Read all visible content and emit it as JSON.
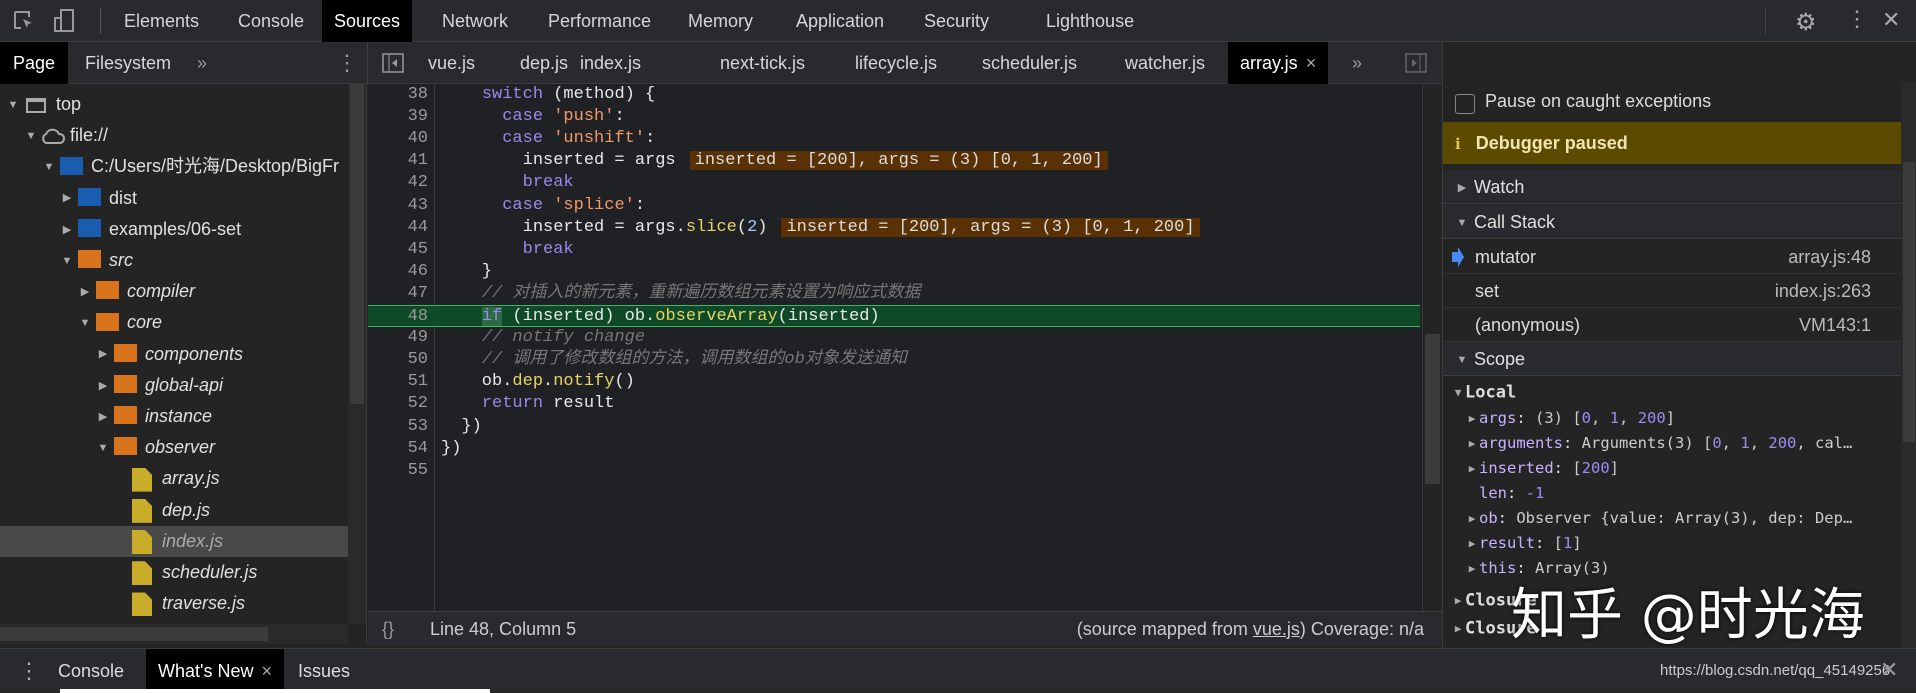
{
  "main_tabs": [
    "Elements",
    "Console",
    "Sources",
    "Network",
    "Performance",
    "Memory",
    "Application",
    "Security",
    "Lighthouse"
  ],
  "active_main_tab": "Sources",
  "navigator_tabs": {
    "page": "Page",
    "filesystem": "Filesystem",
    "more": "»"
  },
  "file_tabs": [
    "vue.js",
    "dep.js",
    "index.js",
    "next-tick.js",
    "lifecycle.js",
    "scheduler.js",
    "watcher.js",
    "array.js"
  ],
  "active_file_tab": "array.js",
  "more_tabs": "»",
  "close_glyph": "×",
  "tree": [
    {
      "label": "top",
      "depth": 0,
      "icon": "frame",
      "arrow": "down"
    },
    {
      "label": "file://",
      "depth": 1,
      "icon": "cloud",
      "arrow": "down"
    },
    {
      "label": "C:/Users/时光海/Desktop/BigFr",
      "depth": 2,
      "icon": "folder-blue",
      "arrow": "down"
    },
    {
      "label": "dist",
      "depth": 3,
      "icon": "folder-blue",
      "arrow": "right"
    },
    {
      "label": "examples/06-set",
      "depth": 3,
      "icon": "folder-blue",
      "arrow": "right"
    },
    {
      "label": "src",
      "depth": 3,
      "icon": "folder-orange",
      "arrow": "down",
      "italic": true
    },
    {
      "label": "compiler",
      "depth": 4,
      "icon": "folder-orange",
      "arrow": "right",
      "italic": true
    },
    {
      "label": "core",
      "depth": 4,
      "icon": "folder-orange",
      "arrow": "down",
      "italic": true
    },
    {
      "label": "components",
      "depth": 5,
      "icon": "folder-orange",
      "arrow": "right",
      "italic": true
    },
    {
      "label": "global-api",
      "depth": 5,
      "icon": "folder-orange",
      "arrow": "right",
      "italic": true
    },
    {
      "label": "instance",
      "depth": 5,
      "icon": "folder-orange",
      "arrow": "right",
      "italic": true
    },
    {
      "label": "observer",
      "depth": 5,
      "icon": "folder-orange",
      "arrow": "down",
      "italic": true
    },
    {
      "label": "array.js",
      "depth": 6,
      "icon": "file",
      "italic": true
    },
    {
      "label": "dep.js",
      "depth": 6,
      "icon": "file",
      "italic": true
    },
    {
      "label": "index.js",
      "depth": 6,
      "icon": "file",
      "italic": true,
      "selected": true
    },
    {
      "label": "scheduler.js",
      "depth": 6,
      "icon": "file",
      "italic": true
    },
    {
      "label": "traverse.js",
      "depth": 6,
      "icon": "file",
      "italic": true
    }
  ],
  "code": {
    "current_line": 48,
    "lines": [
      {
        "n": 38,
        "t": [
          [
            "    ",
            ""
          ],
          [
            "switch",
            "kw"
          ],
          [
            " (method) {",
            "id"
          ]
        ]
      },
      {
        "n": 39,
        "t": [
          [
            "      ",
            ""
          ],
          [
            "case",
            "kw"
          ],
          [
            " ",
            ""
          ],
          [
            "'push'",
            "str"
          ],
          [
            ":",
            "id"
          ]
        ]
      },
      {
        "n": 40,
        "t": [
          [
            "      ",
            ""
          ],
          [
            "case",
            "kw"
          ],
          [
            " ",
            ""
          ],
          [
            "'unshift'",
            "str"
          ],
          [
            ":",
            "id"
          ]
        ]
      },
      {
        "n": 41,
        "t": [
          [
            "        inserted = args",
            "id"
          ]
        ],
        "inline": "inserted = [200], args = (3) [0, 1, 200]"
      },
      {
        "n": 42,
        "t": [
          [
            "        ",
            ""
          ],
          [
            "break",
            "kw"
          ]
        ]
      },
      {
        "n": 43,
        "t": [
          [
            "      ",
            ""
          ],
          [
            "case",
            "kw"
          ],
          [
            " ",
            ""
          ],
          [
            "'splice'",
            "str"
          ],
          [
            ":",
            "id"
          ]
        ]
      },
      {
        "n": 44,
        "t": [
          [
            "        inserted = args.",
            "id"
          ],
          [
            "slice",
            "fn"
          ],
          [
            "(",
            "id"
          ],
          [
            "2",
            "num"
          ],
          [
            ")",
            "id"
          ]
        ],
        "inline": "inserted = [200], args = (3) [0, 1, 200]"
      },
      {
        "n": 45,
        "t": [
          [
            "        ",
            ""
          ],
          [
            "break",
            "kw"
          ]
        ]
      },
      {
        "n": 46,
        "t": [
          [
            "    }",
            "id"
          ]
        ]
      },
      {
        "n": 47,
        "t": [
          [
            "    ",
            ""
          ],
          [
            "// 对插入的新元素，重新遍历数组元素设置为响应式数据",
            "cm"
          ]
        ]
      },
      {
        "n": 48,
        "t": [
          [
            "    ",
            ""
          ],
          [
            "if",
            "kw"
          ],
          [
            " (inserted) ob.",
            "id"
          ],
          [
            "observeArray",
            "fn"
          ],
          [
            "(inserted)",
            "id"
          ]
        ]
      },
      {
        "n": 49,
        "t": [
          [
            "    ",
            ""
          ],
          [
            "// notify change",
            "cm"
          ]
        ]
      },
      {
        "n": 50,
        "t": [
          [
            "    ",
            ""
          ],
          [
            "// 调用了修改数组的方法，调用数组的ob对象发送通知",
            "cm"
          ]
        ]
      },
      {
        "n": 51,
        "t": [
          [
            "    ob.",
            "id"
          ],
          [
            "dep",
            "fn"
          ],
          [
            ".",
            "id"
          ],
          [
            "notify",
            "fn"
          ],
          [
            "()",
            "id"
          ]
        ]
      },
      {
        "n": 52,
        "t": [
          [
            "    ",
            ""
          ],
          [
            "return",
            "kw"
          ],
          [
            " result",
            "id"
          ]
        ]
      },
      {
        "n": 53,
        "t": [
          [
            "  })",
            "id"
          ]
        ]
      },
      {
        "n": 54,
        "t": [
          [
            "})",
            "id"
          ]
        ]
      },
      {
        "n": 55,
        "t": []
      }
    ]
  },
  "status": {
    "format_icon": "{}",
    "position": "Line 48, Column 5",
    "mapped_prefix": "(source mapped from ",
    "mapped_link": "vue.js",
    "mapped_suffix": ")",
    "coverage": "Coverage: n/a"
  },
  "debugger": {
    "pause_on_caught": "Pause on caught exceptions",
    "paused_banner": "Debugger paused",
    "info_glyph": "i",
    "watch": "Watch",
    "call_stack": "Call Stack",
    "frames": [
      {
        "name": "mutator",
        "loc": "array.js:48",
        "current": true
      },
      {
        "name": "set",
        "loc": "index.js:263"
      },
      {
        "name": "(anonymous)",
        "loc": "VM143:1"
      }
    ],
    "scope": "Scope",
    "local": "Local",
    "vars": [
      {
        "k": "args",
        "v": "(3) [0, 1, 200]",
        "exp": true
      },
      {
        "k": "arguments",
        "v": "Arguments(3) [0, 1, 200, cal…",
        "exp": true
      },
      {
        "k": "inserted",
        "v": "[200]",
        "exp": true
      },
      {
        "k": "len",
        "v": "-1",
        "exp": false
      },
      {
        "k": "ob",
        "v": "Observer {value: Array(3), dep: Dep…",
        "exp": true
      },
      {
        "k": "result",
        "v": "[1]",
        "exp": true
      },
      {
        "k": "this",
        "v": "Array(3)",
        "exp": true
      }
    ],
    "closures": [
      "Closure",
      "Closure"
    ]
  },
  "drawer": {
    "tabs": [
      "Console",
      "What's New",
      "Issues"
    ],
    "active": "What's New"
  },
  "watermark": {
    "zhihu": "知乎 @时光海",
    "csdn": "https://blog.csdn.net/qq_45149256"
  }
}
